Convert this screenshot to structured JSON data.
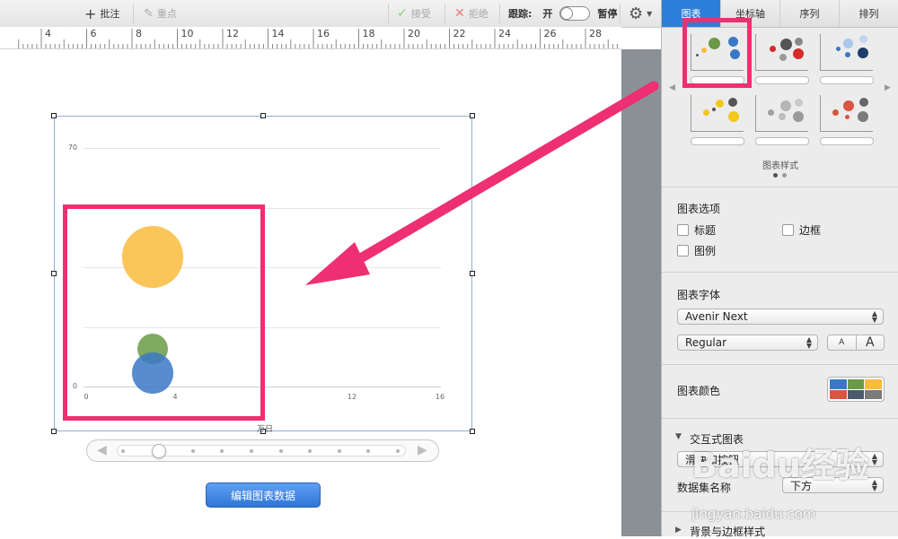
{
  "toolbar": {
    "comment_label": "批注",
    "highlight_label": "重点",
    "accept_label": "接受",
    "reject_label": "拒绝",
    "tracking_label": "跟踪:",
    "on_label": "开",
    "pause_label": "暂停"
  },
  "ruler": {
    "ticks": [
      "4",
      "6",
      "8",
      "10",
      "12",
      "14",
      "16",
      "18",
      "20",
      "22",
      "24",
      "26",
      "28"
    ]
  },
  "chart": {
    "y_ticks": [
      "70",
      "",
      "",
      "",
      "0"
    ],
    "x_ticks": [
      "0",
      "4",
      "",
      "12",
      "16"
    ],
    "x_axis_label": "万日"
  },
  "chart_data": {
    "type": "scatter",
    "subtype": "bubble",
    "ylim": [
      0,
      70
    ],
    "xlim": [
      0,
      16
    ],
    "y_ticks": [
      0,
      17.5,
      35,
      52.5,
      70
    ],
    "x_ticks": [
      0,
      4,
      8,
      12,
      16
    ],
    "points": [
      {
        "x": 3,
        "y": 38,
        "size": 18,
        "color": "#f9bb3c"
      },
      {
        "x": 3,
        "y": 11,
        "size": 9,
        "color": "#6a9a46"
      },
      {
        "x": 3,
        "y": 4,
        "size": 12,
        "color": "#3a78c5"
      }
    ],
    "grid": true
  },
  "edit_button_label": "编辑图表数据",
  "inspector": {
    "tabs": [
      "图表",
      "坐标轴",
      "序列",
      "排列"
    ],
    "chart_styles_label": "图表样式",
    "options_title": "图表选项",
    "option_title": "标题",
    "option_border": "边框",
    "option_legend": "图例",
    "font_title": "图表字体",
    "font_family": "Avenir Next",
    "font_weight": "Regular",
    "font_smaller": "A",
    "font_larger": "A",
    "colors_title": "图表颜色",
    "interactive_title": "交互式图表",
    "interactive_mode": "滑块和按钮",
    "dataset_name_label": "数据集名称",
    "dataset_name_value": "下方",
    "bg_border_title": "背景与边框样式"
  },
  "colors": {
    "accent": "#2c7fd8",
    "annotation": "#ee2f72",
    "palette": [
      "#3a78c5",
      "#6a9a46",
      "#f9bb3c",
      "#d9553f",
      "#4c5a6e",
      "#7a7a7a"
    ]
  },
  "watermark": {
    "logo_text": "Baidu经验",
    "url": "jingyan.baidu.com"
  }
}
